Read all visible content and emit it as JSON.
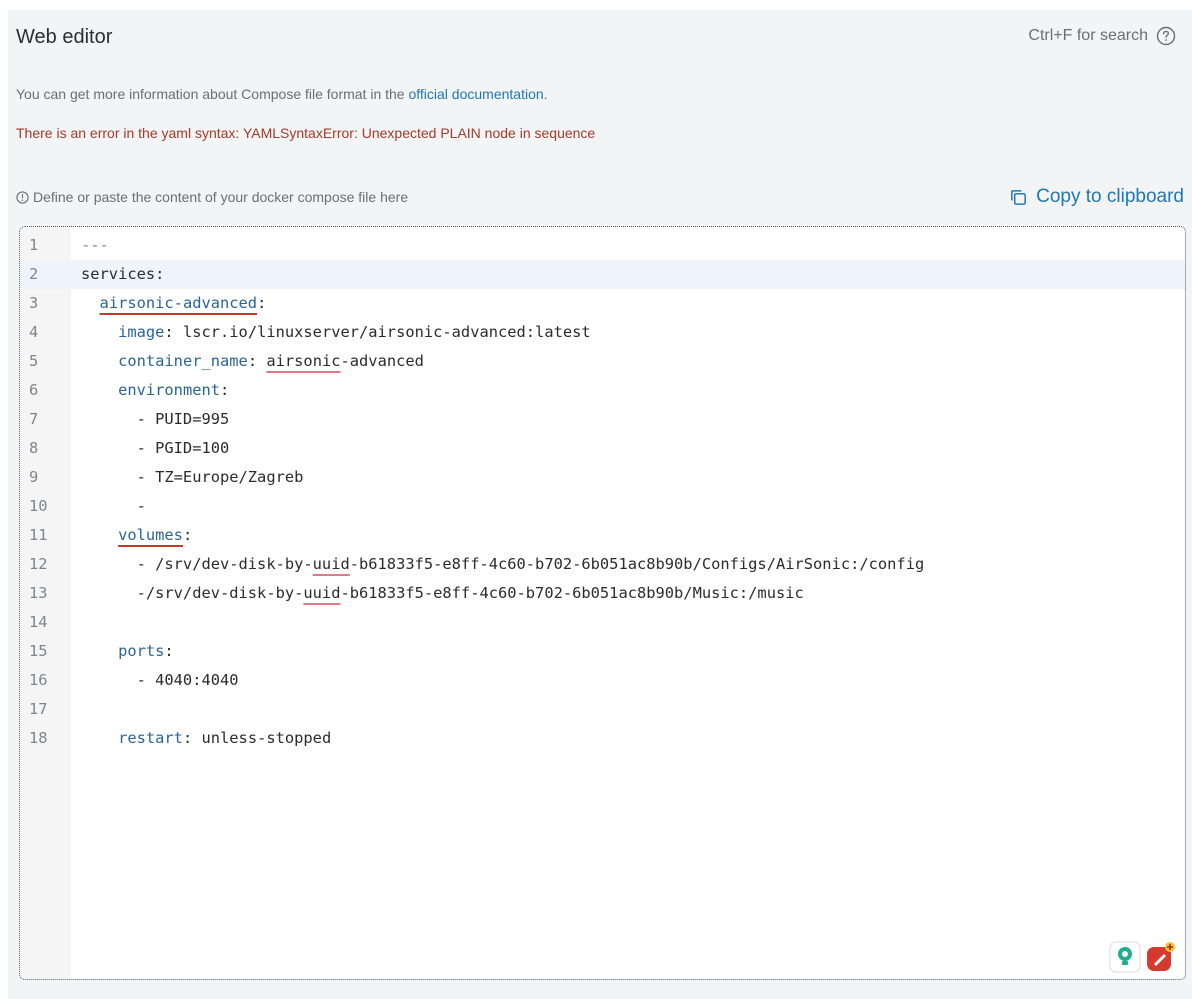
{
  "header": {
    "title": "Web editor",
    "search_hint": "Ctrl+F for search"
  },
  "info": {
    "prefix": "You can get more information about Compose file format in the ",
    "link": "official documentation",
    "suffix": "."
  },
  "error": "There is an error in the yaml syntax: YAMLSyntaxError: Unexpected PLAIN node in sequence",
  "hint": "Define or paste the content of your docker compose file here",
  "copy_label": "Copy to clipboard",
  "editor": {
    "active_line": 2,
    "lines": [
      {
        "n": "1",
        "segments": [
          {
            "t": "---",
            "c": "sep"
          }
        ]
      },
      {
        "n": "2",
        "segments": [
          {
            "t": "services:"
          }
        ]
      },
      {
        "n": "3",
        "segments": [
          {
            "t": "  "
          },
          {
            "t": "airsonic-advanced",
            "c": "key sq-red"
          },
          {
            "t": ":"
          }
        ]
      },
      {
        "n": "4",
        "segments": [
          {
            "t": "    "
          },
          {
            "t": "image",
            "c": "key"
          },
          {
            "t": ": lscr.io/linuxserver/airsonic-advanced:latest"
          }
        ]
      },
      {
        "n": "5",
        "segments": [
          {
            "t": "    "
          },
          {
            "t": "container_name",
            "c": "key"
          },
          {
            "t": ": "
          },
          {
            "t": "airsonic",
            "c": "sq-pink"
          },
          {
            "t": "-advanced"
          }
        ]
      },
      {
        "n": "6",
        "segments": [
          {
            "t": "    "
          },
          {
            "t": "environment",
            "c": "key"
          },
          {
            "t": ":"
          }
        ]
      },
      {
        "n": "7",
        "segments": [
          {
            "t": "      - PUID=995"
          }
        ]
      },
      {
        "n": "8",
        "segments": [
          {
            "t": "      - PGID=100"
          }
        ]
      },
      {
        "n": "9",
        "segments": [
          {
            "t": "      - TZ=Europe/Zagreb"
          }
        ]
      },
      {
        "n": "10",
        "segments": [
          {
            "t": "      -"
          }
        ]
      },
      {
        "n": "11",
        "segments": [
          {
            "t": "    "
          },
          {
            "t": "volumes",
            "c": "key sq-red"
          },
          {
            "t": ":"
          }
        ]
      },
      {
        "n": "12",
        "segments": [
          {
            "t": "      - /srv/dev-disk-by-"
          },
          {
            "t": "uuid",
            "c": "sq-pink"
          },
          {
            "t": "-b61833f5-e8ff-4c60-b702-6b051ac8b90b/Configs/AirSonic:/config"
          }
        ]
      },
      {
        "n": "13",
        "segments": [
          {
            "t": "      -/srv/dev-disk-by-"
          },
          {
            "t": "uuid",
            "c": "sq-pink"
          },
          {
            "t": "-b61833f5-e8ff-4c60-b702-6b051ac8b90b/Music:/music"
          }
        ]
      },
      {
        "n": "14",
        "segments": []
      },
      {
        "n": "15",
        "segments": [
          {
            "t": "    "
          },
          {
            "t": "ports",
            "c": "key"
          },
          {
            "t": ":"
          }
        ]
      },
      {
        "n": "16",
        "segments": [
          {
            "t": "      - 4040:4040"
          }
        ]
      },
      {
        "n": "17",
        "segments": []
      },
      {
        "n": "18",
        "segments": [
          {
            "t": "    "
          },
          {
            "t": "restart",
            "c": "key"
          },
          {
            "t": ": unless-stopped"
          }
        ]
      }
    ]
  },
  "icons": {
    "help": "question-circle-icon",
    "info": "info-circle-icon",
    "copy": "copy-icon",
    "ext1": "lightbulb-extension-icon",
    "ext2": "pen-extension-icon"
  },
  "colors": {
    "accent": "#1f78b4",
    "error": "#a23b2a",
    "yaml_key": "#2a6496",
    "squiggle_error": "#c0392b",
    "squiggle_spell": "#e07a8a"
  }
}
